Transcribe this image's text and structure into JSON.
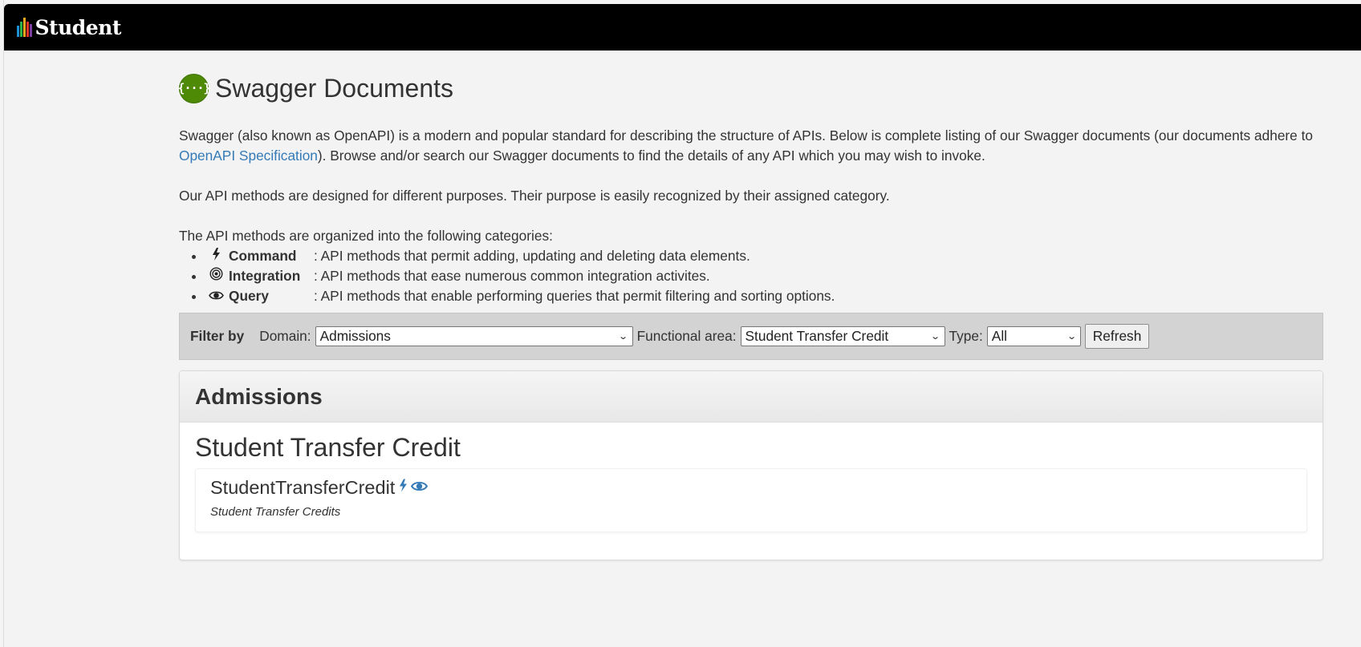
{
  "app": {
    "brand": "Student",
    "logo_colors": [
      "#1e90d6",
      "#2bb24c",
      "#f6a61e",
      "#e5332a",
      "#7a3fa0"
    ]
  },
  "page": {
    "title": "Swagger Documents",
    "title_icon": "swagger-braces-icon",
    "title_icon_glyph": "{···}",
    "intro": {
      "before_link": "Swagger (also known as OpenAPI) is a modern and popular standard for describing the structure of APIs. Below is complete listing of our Swagger documents (our documents adhere to ",
      "link_text": "OpenAPI Specification",
      "after_link": "). Browse and/or search our Swagger documents to find the details of any API which you may wish to invoke."
    },
    "purpose_text": "Our API methods are designed for different purposes. Their purpose is easily recognized by their assigned category.",
    "categories_intro": "The API methods are organized into the following categories:",
    "categories": [
      {
        "icon": "bolt-icon",
        "glyph": "ϟ",
        "name": "Command",
        "description": ": API methods that permit adding, updating and deleting data elements."
      },
      {
        "icon": "target-icon",
        "glyph": "◎",
        "name": "Integration",
        "description": ": API methods that ease numerous common integration activites."
      },
      {
        "icon": "eye-icon",
        "glyph": "👁",
        "name": "Query",
        "description": ": API methods that enable performing queries that permit filtering and sorting options."
      }
    ]
  },
  "filter": {
    "label": "Filter by",
    "domain_label": "Domain:",
    "domain_value": "Admissions",
    "area_label": "Functional area:",
    "area_value": "Student Transfer Credit",
    "type_label": "Type:",
    "type_value": "All",
    "refresh_label": "Refresh"
  },
  "results": {
    "domain_title": "Admissions",
    "area_title": "Student Transfer Credit",
    "documents": [
      {
        "name": "StudentTransferCredit",
        "icons": [
          "bolt-icon",
          "eye-icon"
        ],
        "description": "Student Transfer Credits"
      }
    ]
  },
  "colors": {
    "link": "#337ab7",
    "swagger_green": "#4e8a05",
    "topbar": "#000000"
  }
}
